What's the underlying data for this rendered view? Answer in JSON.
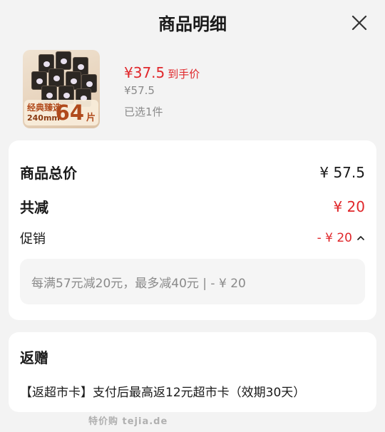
{
  "header": {
    "title": "商品明细",
    "close_icon": "close-icon"
  },
  "product": {
    "badge_line1": "经典臻选",
    "badge_line2": "240mm",
    "badge_count": "64",
    "badge_unit": "片",
    "price": "¥37.5",
    "price_suffix": "到手价",
    "original_price": "¥57.5",
    "selected_qty": "已选1件"
  },
  "summary": {
    "total_label": "商品总价",
    "total_value": "¥ 57.5",
    "discount_label": "共减",
    "discount_value": "¥ 20",
    "promo_label": "促销",
    "promo_value": "- ¥ 20",
    "promo_detail": "每满57元减20元，最多减40元 | - ¥ 20"
  },
  "gift": {
    "title": "返赠",
    "text": "【返超市卡】支付后最高返12元超市卡（效期30天）"
  },
  "watermark": {
    "text": "特价购 tejia.de"
  },
  "colors": {
    "accent_red": "#e0272b",
    "muted_gray": "#8a8a8a",
    "background": "#f3f3f3"
  }
}
